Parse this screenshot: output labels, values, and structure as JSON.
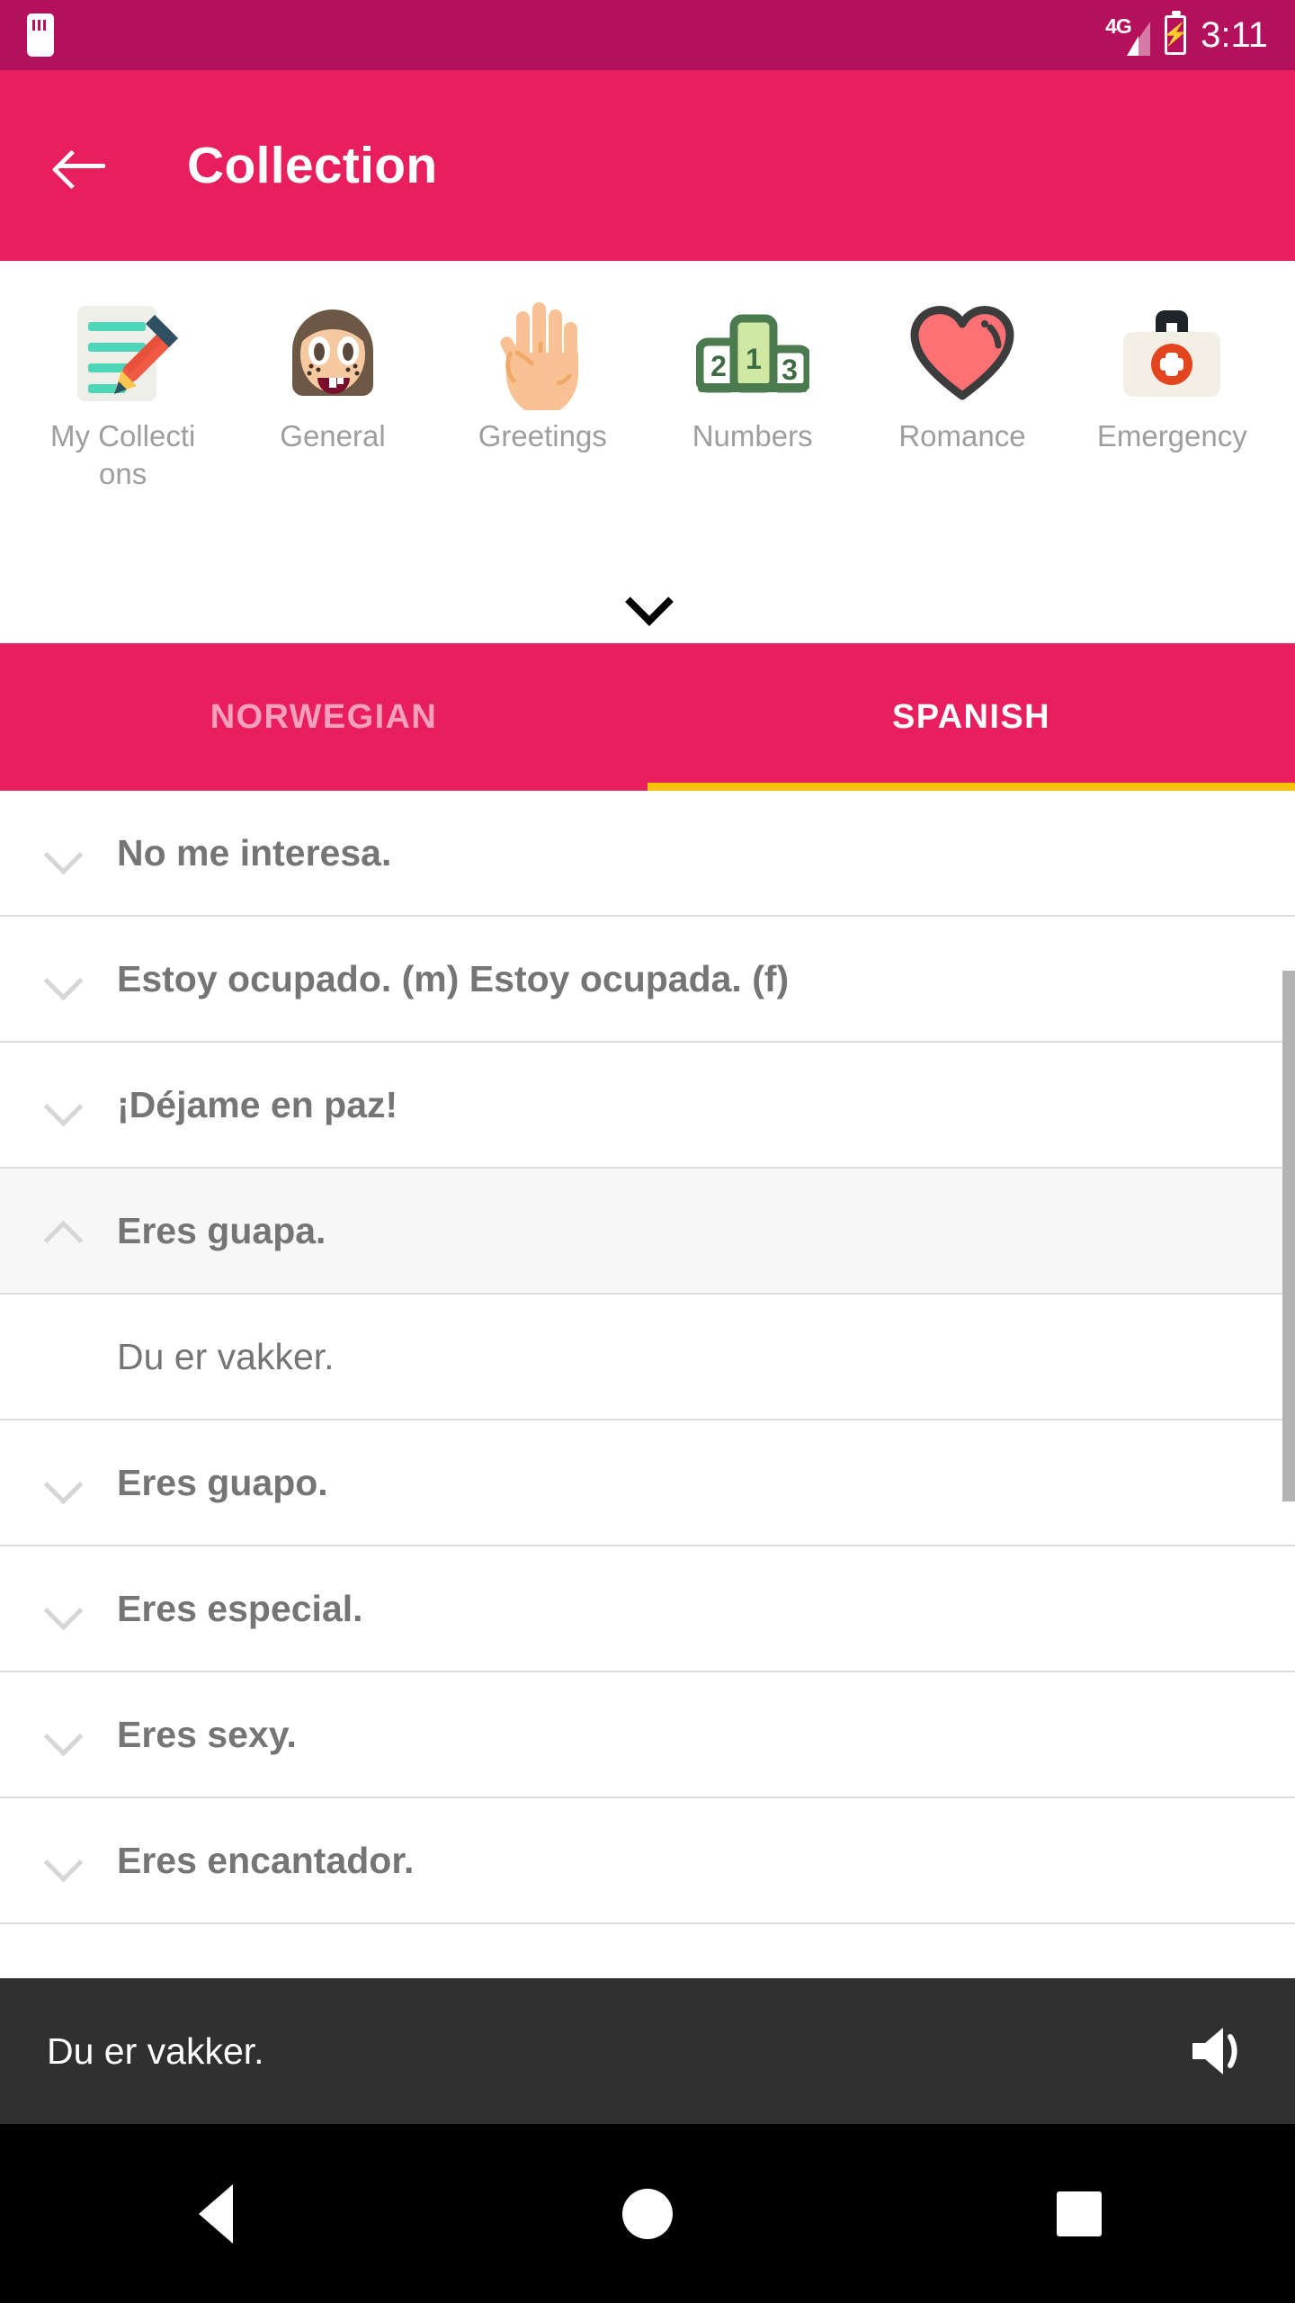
{
  "status_bar": {
    "sd_card_icon": "sd-card-icon",
    "network": "4G",
    "signal_icon": "signal-bars-icon",
    "battery_icon": "battery-charging-icon",
    "time": "3:11"
  },
  "app_bar": {
    "back_icon": "back-arrow-icon",
    "title": "Collection"
  },
  "categories": {
    "expand_icon": "chevron-down-icon",
    "items": [
      {
        "label": "My Collections",
        "icon": "memo-pencil-icon"
      },
      {
        "label": "General",
        "icon": "girl-face-icon"
      },
      {
        "label": "Greetings",
        "icon": "raised-hand-icon"
      },
      {
        "label": "Numbers",
        "icon": "podium-123-icon"
      },
      {
        "label": "Romance",
        "icon": "heart-icon"
      },
      {
        "label": "Emergency",
        "icon": "first-aid-kit-icon"
      }
    ]
  },
  "tabs": [
    {
      "label": "NORWEGIAN",
      "active": false
    },
    {
      "label": "SPANISH",
      "active": true
    }
  ],
  "accent_colors": {
    "status_bar": "#B5105C",
    "app_bar": "#E81E5F",
    "tab_indicator": "#FFC107",
    "play_bar": "#303030",
    "nav_bar": "#000000"
  },
  "list": {
    "rows": [
      {
        "phrase": "No me interesa.",
        "expanded": false,
        "chevron": "chevron-down-icon"
      },
      {
        "phrase": "Estoy ocupado. (m)  Estoy ocupada. (f)",
        "expanded": false,
        "chevron": "chevron-down-icon"
      },
      {
        "phrase": "¡Déjame en paz!",
        "expanded": false,
        "chevron": "chevron-down-icon"
      },
      {
        "phrase": "Eres guapa.",
        "expanded": true,
        "chevron": "chevron-up-icon",
        "translation": "Du er vakker."
      },
      {
        "phrase": "Eres guapo.",
        "expanded": false,
        "chevron": "chevron-down-icon"
      },
      {
        "phrase": "Eres especial.",
        "expanded": false,
        "chevron": "chevron-down-icon"
      },
      {
        "phrase": "Eres sexy.",
        "expanded": false,
        "chevron": "chevron-down-icon"
      },
      {
        "phrase": "Eres encantador.",
        "expanded": false,
        "chevron": "chevron-down-icon"
      }
    ]
  },
  "play_bar": {
    "text": "Du er vakker.",
    "speaker_icon": "speaker-volume-icon"
  },
  "nav_bar": {
    "back_icon": "nav-back-triangle-icon",
    "home_icon": "nav-home-circle-icon",
    "recents_icon": "nav-recents-square-icon"
  }
}
